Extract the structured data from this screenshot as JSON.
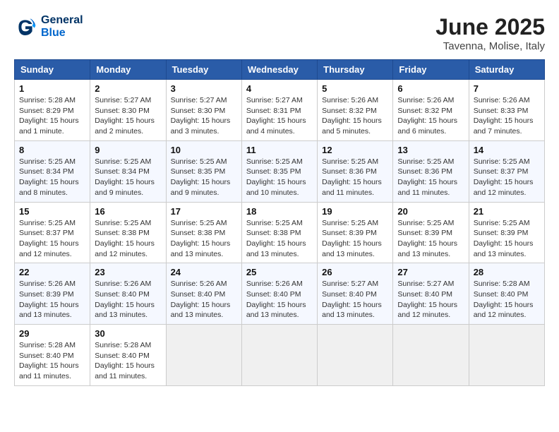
{
  "header": {
    "logo_line1": "General",
    "logo_line2": "Blue",
    "month": "June 2025",
    "location": "Tavenna, Molise, Italy"
  },
  "weekdays": [
    "Sunday",
    "Monday",
    "Tuesday",
    "Wednesday",
    "Thursday",
    "Friday",
    "Saturday"
  ],
  "weeks": [
    [
      {
        "day": 1,
        "lines": [
          "Sunrise: 5:28 AM",
          "Sunset: 8:29 PM",
          "Daylight: 15 hours",
          "and 1 minute."
        ]
      },
      {
        "day": 2,
        "lines": [
          "Sunrise: 5:27 AM",
          "Sunset: 8:30 PM",
          "Daylight: 15 hours",
          "and 2 minutes."
        ]
      },
      {
        "day": 3,
        "lines": [
          "Sunrise: 5:27 AM",
          "Sunset: 8:30 PM",
          "Daylight: 15 hours",
          "and 3 minutes."
        ]
      },
      {
        "day": 4,
        "lines": [
          "Sunrise: 5:27 AM",
          "Sunset: 8:31 PM",
          "Daylight: 15 hours",
          "and 4 minutes."
        ]
      },
      {
        "day": 5,
        "lines": [
          "Sunrise: 5:26 AM",
          "Sunset: 8:32 PM",
          "Daylight: 15 hours",
          "and 5 minutes."
        ]
      },
      {
        "day": 6,
        "lines": [
          "Sunrise: 5:26 AM",
          "Sunset: 8:32 PM",
          "Daylight: 15 hours",
          "and 6 minutes."
        ]
      },
      {
        "day": 7,
        "lines": [
          "Sunrise: 5:26 AM",
          "Sunset: 8:33 PM",
          "Daylight: 15 hours",
          "and 7 minutes."
        ]
      }
    ],
    [
      {
        "day": 8,
        "lines": [
          "Sunrise: 5:25 AM",
          "Sunset: 8:34 PM",
          "Daylight: 15 hours",
          "and 8 minutes."
        ]
      },
      {
        "day": 9,
        "lines": [
          "Sunrise: 5:25 AM",
          "Sunset: 8:34 PM",
          "Daylight: 15 hours",
          "and 9 minutes."
        ]
      },
      {
        "day": 10,
        "lines": [
          "Sunrise: 5:25 AM",
          "Sunset: 8:35 PM",
          "Daylight: 15 hours",
          "and 9 minutes."
        ]
      },
      {
        "day": 11,
        "lines": [
          "Sunrise: 5:25 AM",
          "Sunset: 8:35 PM",
          "Daylight: 15 hours",
          "and 10 minutes."
        ]
      },
      {
        "day": 12,
        "lines": [
          "Sunrise: 5:25 AM",
          "Sunset: 8:36 PM",
          "Daylight: 15 hours",
          "and 11 minutes."
        ]
      },
      {
        "day": 13,
        "lines": [
          "Sunrise: 5:25 AM",
          "Sunset: 8:36 PM",
          "Daylight: 15 hours",
          "and 11 minutes."
        ]
      },
      {
        "day": 14,
        "lines": [
          "Sunrise: 5:25 AM",
          "Sunset: 8:37 PM",
          "Daylight: 15 hours",
          "and 12 minutes."
        ]
      }
    ],
    [
      {
        "day": 15,
        "lines": [
          "Sunrise: 5:25 AM",
          "Sunset: 8:37 PM",
          "Daylight: 15 hours",
          "and 12 minutes."
        ]
      },
      {
        "day": 16,
        "lines": [
          "Sunrise: 5:25 AM",
          "Sunset: 8:38 PM",
          "Daylight: 15 hours",
          "and 12 minutes."
        ]
      },
      {
        "day": 17,
        "lines": [
          "Sunrise: 5:25 AM",
          "Sunset: 8:38 PM",
          "Daylight: 15 hours",
          "and 13 minutes."
        ]
      },
      {
        "day": 18,
        "lines": [
          "Sunrise: 5:25 AM",
          "Sunset: 8:38 PM",
          "Daylight: 15 hours",
          "and 13 minutes."
        ]
      },
      {
        "day": 19,
        "lines": [
          "Sunrise: 5:25 AM",
          "Sunset: 8:39 PM",
          "Daylight: 15 hours",
          "and 13 minutes."
        ]
      },
      {
        "day": 20,
        "lines": [
          "Sunrise: 5:25 AM",
          "Sunset: 8:39 PM",
          "Daylight: 15 hours",
          "and 13 minutes."
        ]
      },
      {
        "day": 21,
        "lines": [
          "Sunrise: 5:25 AM",
          "Sunset: 8:39 PM",
          "Daylight: 15 hours",
          "and 13 minutes."
        ]
      }
    ],
    [
      {
        "day": 22,
        "lines": [
          "Sunrise: 5:26 AM",
          "Sunset: 8:39 PM",
          "Daylight: 15 hours",
          "and 13 minutes."
        ]
      },
      {
        "day": 23,
        "lines": [
          "Sunrise: 5:26 AM",
          "Sunset: 8:40 PM",
          "Daylight: 15 hours",
          "and 13 minutes."
        ]
      },
      {
        "day": 24,
        "lines": [
          "Sunrise: 5:26 AM",
          "Sunset: 8:40 PM",
          "Daylight: 15 hours",
          "and 13 minutes."
        ]
      },
      {
        "day": 25,
        "lines": [
          "Sunrise: 5:26 AM",
          "Sunset: 8:40 PM",
          "Daylight: 15 hours",
          "and 13 minutes."
        ]
      },
      {
        "day": 26,
        "lines": [
          "Sunrise: 5:27 AM",
          "Sunset: 8:40 PM",
          "Daylight: 15 hours",
          "and 13 minutes."
        ]
      },
      {
        "day": 27,
        "lines": [
          "Sunrise: 5:27 AM",
          "Sunset: 8:40 PM",
          "Daylight: 15 hours",
          "and 12 minutes."
        ]
      },
      {
        "day": 28,
        "lines": [
          "Sunrise: 5:28 AM",
          "Sunset: 8:40 PM",
          "Daylight: 15 hours",
          "and 12 minutes."
        ]
      }
    ],
    [
      {
        "day": 29,
        "lines": [
          "Sunrise: 5:28 AM",
          "Sunset: 8:40 PM",
          "Daylight: 15 hours",
          "and 11 minutes."
        ]
      },
      {
        "day": 30,
        "lines": [
          "Sunrise: 5:28 AM",
          "Sunset: 8:40 PM",
          "Daylight: 15 hours",
          "and 11 minutes."
        ]
      },
      null,
      null,
      null,
      null,
      null
    ]
  ]
}
